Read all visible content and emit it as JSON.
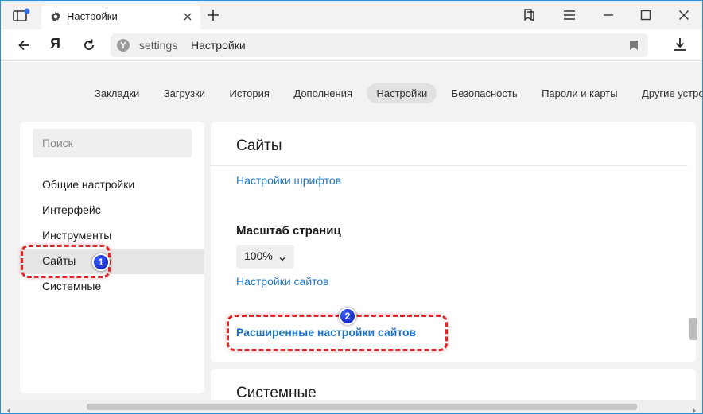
{
  "tab": {
    "title": "Настройки"
  },
  "omnibox": {
    "url": "settings",
    "page_title": "Настройки"
  },
  "nav": {
    "yandex_label": "Я"
  },
  "menu_tabs": [
    {
      "label": "Закладки"
    },
    {
      "label": "Загрузки"
    },
    {
      "label": "История"
    },
    {
      "label": "Дополнения"
    },
    {
      "label": "Настройки",
      "active": true
    },
    {
      "label": "Безопасность"
    },
    {
      "label": "Пароли и карты"
    },
    {
      "label": "Другие устрой"
    }
  ],
  "sidebar": {
    "search_placeholder": "Поиск",
    "items": [
      {
        "label": "Общие настройки"
      },
      {
        "label": "Интерфейс"
      },
      {
        "label": "Инструменты"
      },
      {
        "label": "Сайты",
        "active": true
      },
      {
        "label": "Системные"
      }
    ]
  },
  "main": {
    "heading": "Сайты",
    "font_settings_link": "Настройки шрифтов",
    "page_zoom_label": "Масштаб страниц",
    "zoom_value": "100%",
    "site_settings_link": "Настройки сайтов",
    "advanced_site_settings_link": "Расширенные настройки сайтов"
  },
  "system_section": {
    "heading": "Системные"
  },
  "annotations": [
    {
      "number": "1"
    },
    {
      "number": "2"
    }
  ],
  "colors": {
    "link": "#1a73c9",
    "annotation_border": "#e0262b",
    "annotation_badge": "#0c1ea8",
    "window_border": "#2b8fd6"
  }
}
